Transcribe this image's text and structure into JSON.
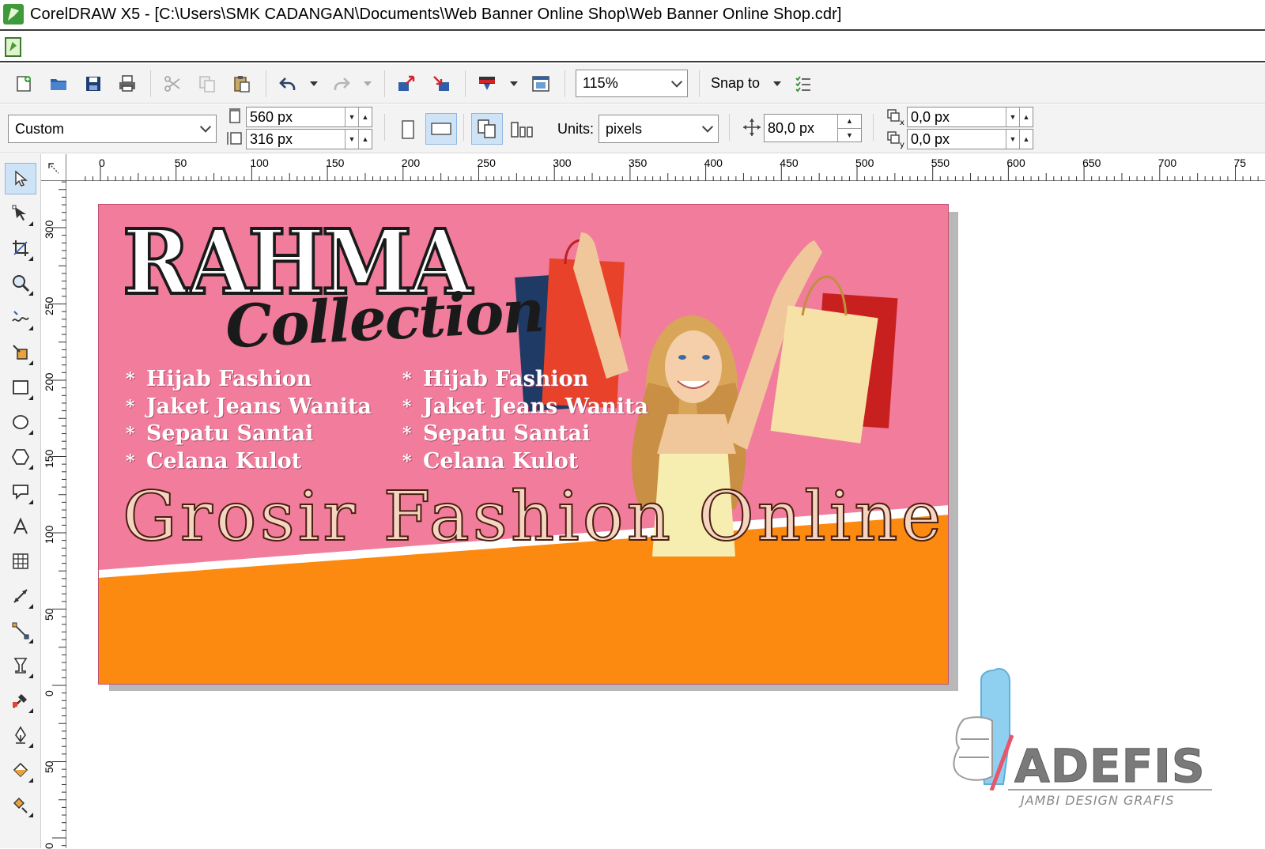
{
  "window": {
    "title": "CorelDRAW X5 - [C:\\Users\\SMK CADANGAN\\Documents\\Web Banner Online Shop\\Web Banner Online Shop.cdr]"
  },
  "toolbar": {
    "zoom": "115%",
    "snap_to": "Snap to"
  },
  "propertybar": {
    "page_preset": "Custom",
    "width": "560 px",
    "height": "316 px",
    "units_label": "Units:",
    "units_value": "pixels",
    "nudge": "80,0 px",
    "dup_x": "0,0 px",
    "dup_y": "0,0 px"
  },
  "rulers": {
    "horizontal": [
      "0",
      "50",
      "100",
      "150",
      "200",
      "250",
      "300",
      "350",
      "400",
      "450",
      "500",
      "550",
      "600",
      "650",
      "700",
      "75"
    ],
    "vertical": [
      "300",
      "250",
      "200",
      "150",
      "100",
      "50",
      "0",
      "50",
      "0"
    ]
  },
  "banner": {
    "brand": "RAHMA",
    "brand_sub": "Collection",
    "list_left": [
      "Hijab Fashion",
      "Jaket Jeans Wanita",
      "Sepatu Santai",
      "Celana Kulot"
    ],
    "list_right": [
      "Hijab Fashion",
      "Jaket Jeans Wanita",
      "Sepatu Santai",
      "Celana Kulot"
    ],
    "bullet": "*",
    "headline": "Grosir Fashion Online",
    "colors": {
      "pink": "#f27c9c",
      "orange": "#fd8a10",
      "stripe": "#ffffff"
    }
  },
  "watermark": {
    "name": "ADEFIS",
    "tagline": "JAMBI DESIGN GRAFIS"
  }
}
